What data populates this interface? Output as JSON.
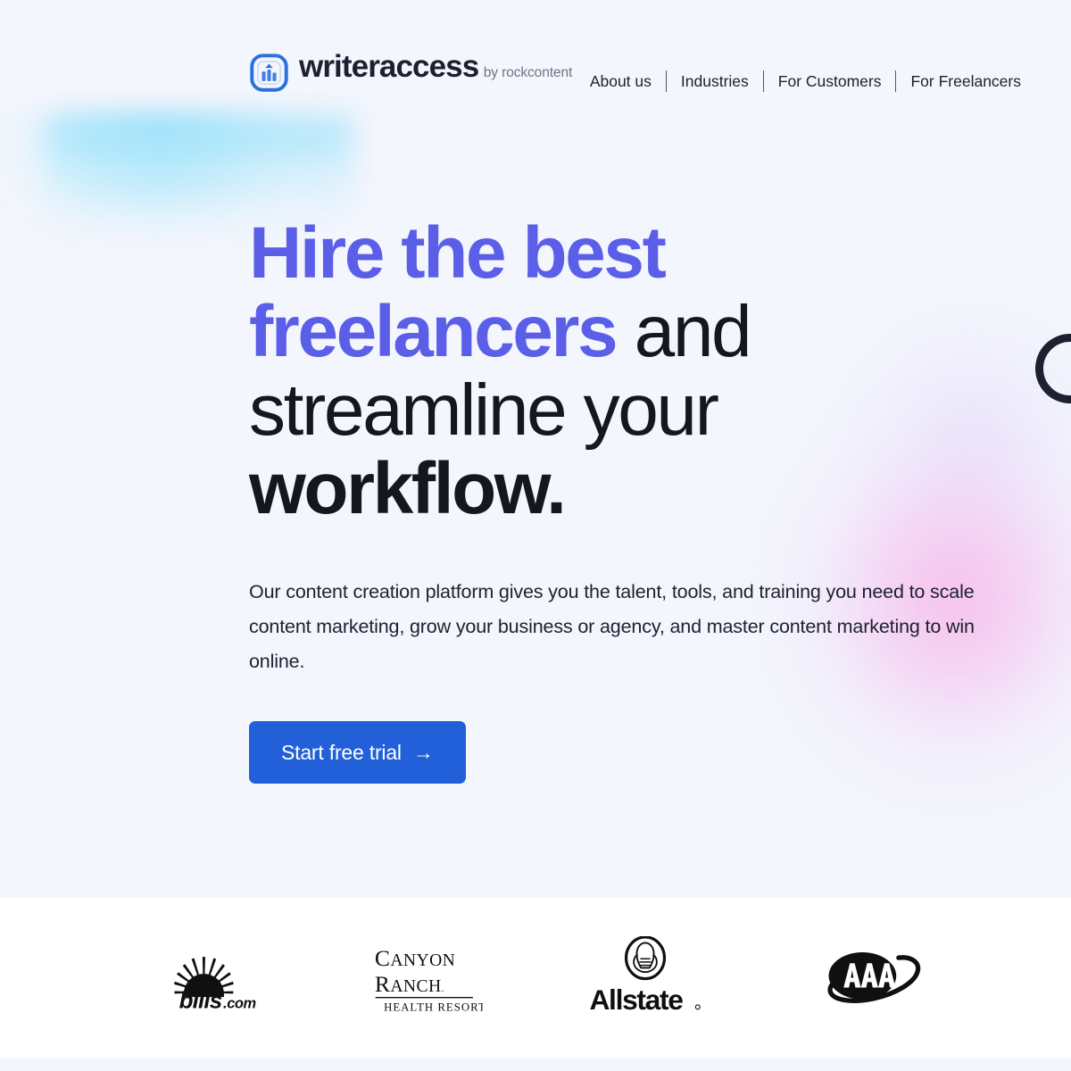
{
  "brand": {
    "name": "writeraccess",
    "tagline": "by rockcontent",
    "logo_icon": "bar-chart-in-rounded-square-icon",
    "accent_color": "#2160d8"
  },
  "nav": {
    "items": [
      {
        "label": "About us"
      },
      {
        "label": "Industries"
      },
      {
        "label": "For Customers"
      },
      {
        "label": "For Freelancers"
      }
    ]
  },
  "hero": {
    "headline": {
      "part1": "Hire the best",
      "part2": "freelancers",
      "part3": " and streamline your ",
      "part4": "workflow.",
      "accent_color": "#5b5fe8",
      "text_color": "#15171f"
    },
    "paragraph": "Our content creation platform gives you the talent, tools, and training you need to scale content marketing, grow your business or agency, and master content marketing to win online.",
    "cta": {
      "label": "Start free trial",
      "arrow": "→",
      "background": "#2160d8",
      "text_color": "#ffffff"
    },
    "background_color": "#f4f6fd",
    "blob_cyan_color": "#96dffa",
    "blob_pink_color": "#f6afe8"
  },
  "client_logos": {
    "items": [
      {
        "name": "bills.com",
        "icon": "bills-dot-com-logo",
        "text": "bills",
        "suffix": ".com"
      },
      {
        "name": "Canyon Ranch Health Resort",
        "icon": "canyon-ranch-logo",
        "line1": "Canyon",
        "line2": "Ranch",
        "registered": "®",
        "line3": "Health Resort"
      },
      {
        "name": "Allstate",
        "icon": "allstate-good-hands-logo",
        "text": "Allstate",
        "registered": "®"
      },
      {
        "name": "AAA",
        "icon": "aaa-oval-logo",
        "text": "AAA"
      }
    ],
    "background_color": "#ffffff"
  }
}
